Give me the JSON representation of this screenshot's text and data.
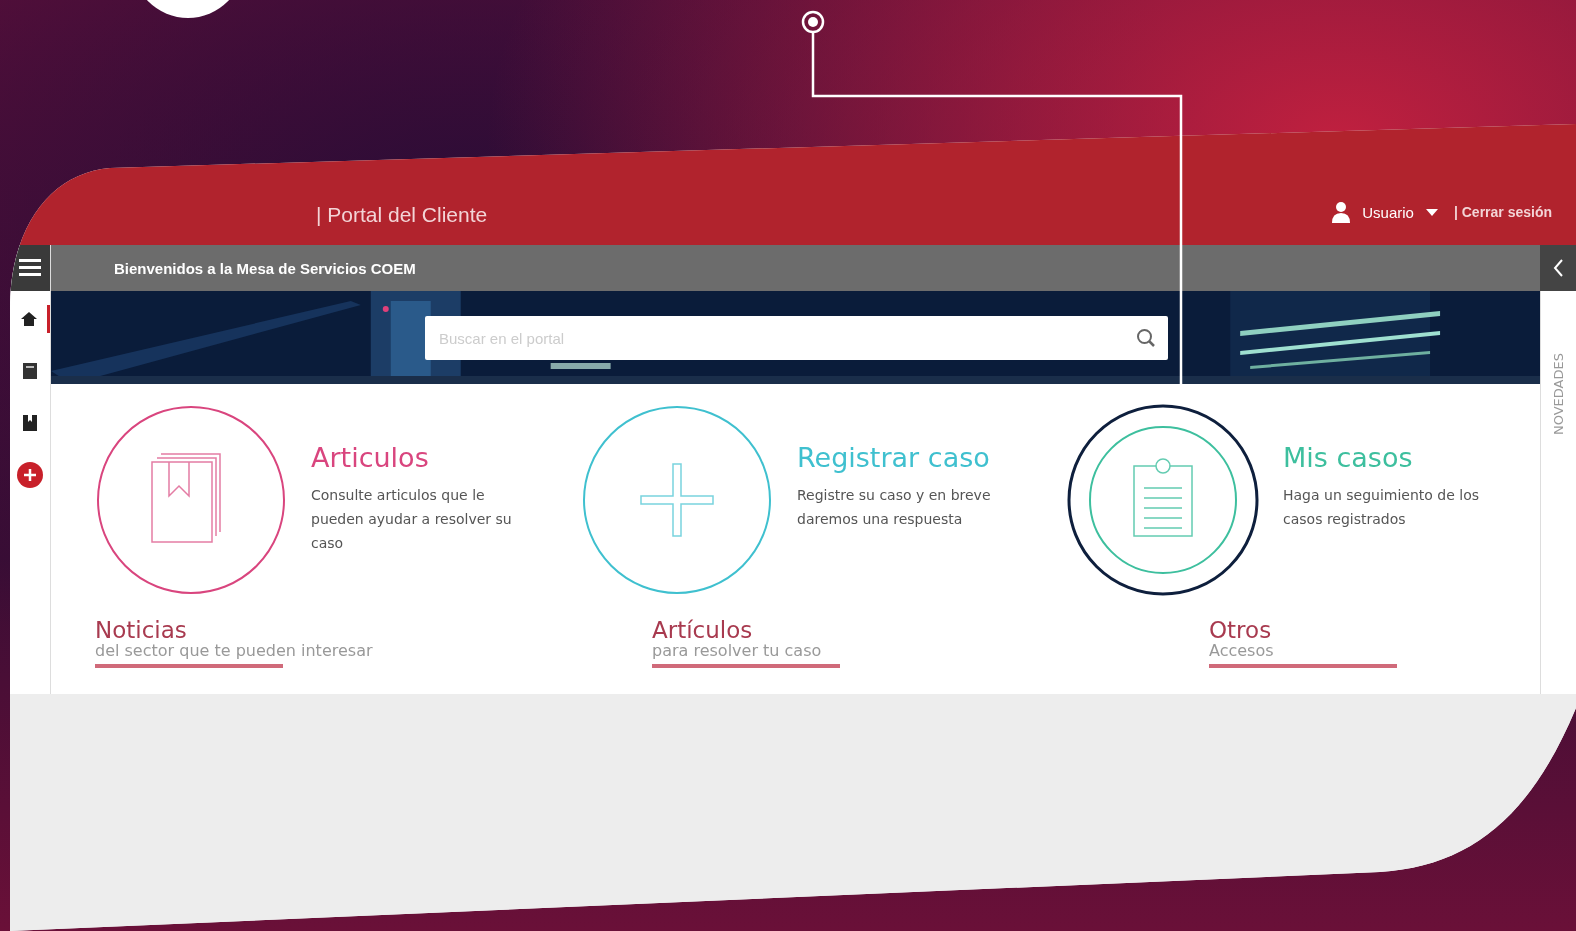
{
  "header": {
    "title": "| Portal del Cliente",
    "user": "Usuario",
    "logout": "| Cerrar sesión"
  },
  "welcome": "Bienvenidos a la Mesa de Servicios COEM",
  "sidebar": {
    "items": [
      {
        "kind": "home",
        "selected": true
      },
      {
        "kind": "document",
        "selected": false
      },
      {
        "kind": "book",
        "selected": false
      },
      {
        "kind": "add",
        "selected": false
      }
    ]
  },
  "search": {
    "placeholder": "Buscar en el portal"
  },
  "cards": [
    {
      "kind": "book",
      "title": "Articulos",
      "description": "Consulte articulos que le pueden ayudar a resolver su caso",
      "color": "#d9457e",
      "highlighted": false
    },
    {
      "kind": "plus",
      "title": "Registrar caso",
      "description": "Registre su caso y en breve daremos una respuesta",
      "color": "#3fc0cf",
      "highlighted": false
    },
    {
      "kind": "clipboard",
      "title": "Mis casos",
      "description": "Haga un seguimiento de los casos registrados",
      "color": "#3dbf9e",
      "highlighted": true
    }
  ],
  "sections": [
    {
      "title": "Noticias",
      "subtitle": "del sector que te pueden interesar"
    },
    {
      "title": "Artículos",
      "subtitle": "para resolver tu caso"
    },
    {
      "title": "Otros",
      "subtitle": "Accesos"
    }
  ],
  "side_panel": {
    "label": "NOVEDADES"
  }
}
